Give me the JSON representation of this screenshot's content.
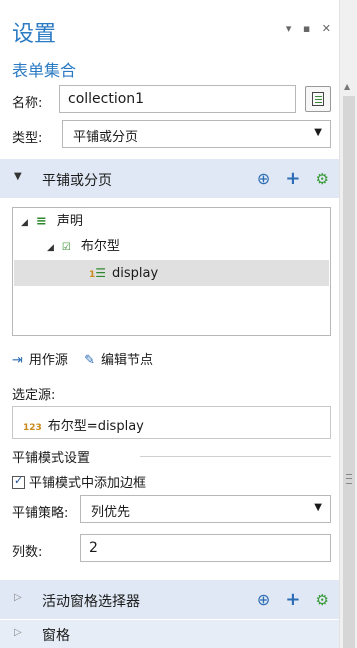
{
  "header": {
    "title": "设置",
    "window_buttons": "▾ ▪ ✕",
    "subtitle": "表单集合"
  },
  "form": {
    "name_label": "名称:",
    "name_value": "collection1",
    "type_label": "类型:",
    "type_value": "平铺或分页"
  },
  "section_tiled": {
    "label": "平铺或分页",
    "tree": [
      {
        "label": "声明",
        "level": 0
      },
      {
        "label": "布尔型",
        "level": 1
      },
      {
        "label": "display",
        "level": 2,
        "selected": true
      }
    ],
    "toolbar": {
      "use_as_source": "用作源",
      "edit_node": "编辑节点"
    },
    "selected_source_label": "选定源:",
    "selected_source_value": "布尔型=display",
    "tile_settings_title": "平铺模式设置",
    "add_border_label": "平铺模式中添加边框",
    "add_border_checked": true,
    "strategy_label": "平铺策略:",
    "strategy_value": "列优先",
    "columns_label": "列数:",
    "columns_value": "2"
  },
  "section_active_pane": {
    "label": "活动窗格选择器"
  },
  "section_pane": {
    "label": "窗格"
  },
  "icons": {
    "number_icon_text": "123",
    "tree_num_icon_text": "1"
  }
}
